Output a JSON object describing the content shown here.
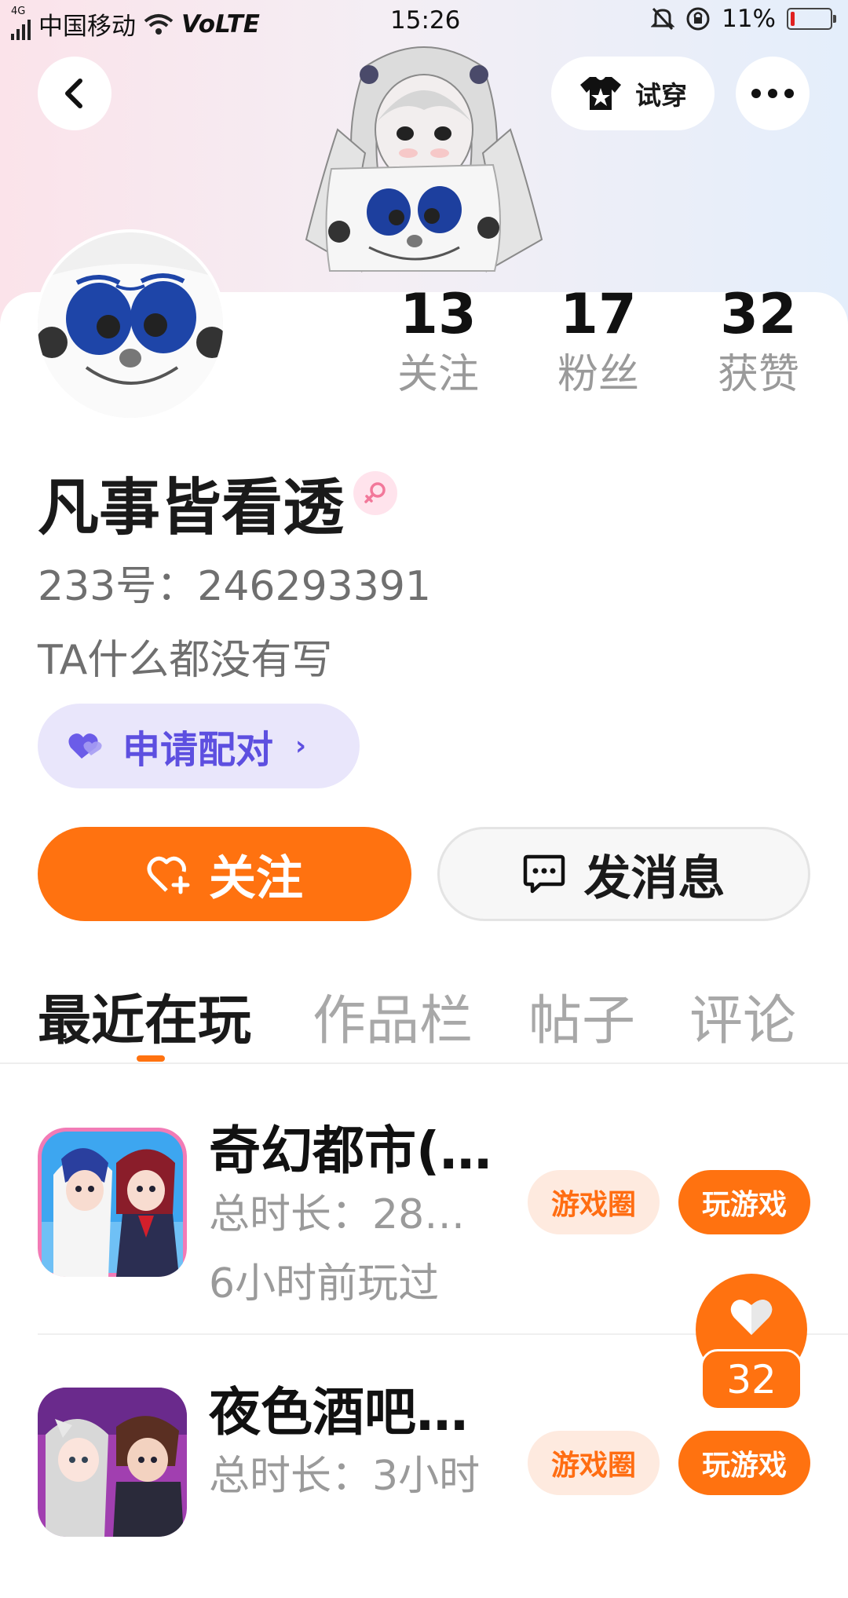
{
  "status_bar": {
    "network": "4G",
    "carrier": "中国移动",
    "volte": "VoLTE",
    "time": "15:26",
    "battery": "11%",
    "battery_level": 0.11
  },
  "header": {
    "tryon_label": "试穿"
  },
  "profile": {
    "stats": [
      {
        "value": "13",
        "label": "关注"
      },
      {
        "value": "17",
        "label": "粉丝"
      },
      {
        "value": "32",
        "label": "获赞"
      }
    ],
    "username": "凡事皆看透",
    "gender": "female",
    "user_id": "233号：246293391",
    "bio": "TA什么都没有写",
    "pair_label": "申请配对",
    "follow_label": "关注",
    "message_label": "发消息"
  },
  "tabs": [
    {
      "label": "最近在玩",
      "active": true
    },
    {
      "label": "作品栏",
      "active": false
    },
    {
      "label": "帖子",
      "active": false
    },
    {
      "label": "评论",
      "active": false
    }
  ],
  "games": [
    {
      "title": "奇幻都市(…",
      "total_time": "总时长：28…",
      "last_played": "6小时前玩过",
      "circle_label": "游戏圈",
      "play_label": "玩游戏"
    },
    {
      "title": "夜色酒吧…",
      "total_time": "总时长：3小时",
      "last_played": "",
      "circle_label": "游戏圈",
      "play_label": "玩游戏"
    }
  ],
  "like_float": {
    "count": "32"
  },
  "colors": {
    "accent": "#ff7210",
    "pair_purple": "#5d4fe0",
    "pair_bg": "#e9e6fb",
    "muted_text": "#9a9a9a"
  }
}
